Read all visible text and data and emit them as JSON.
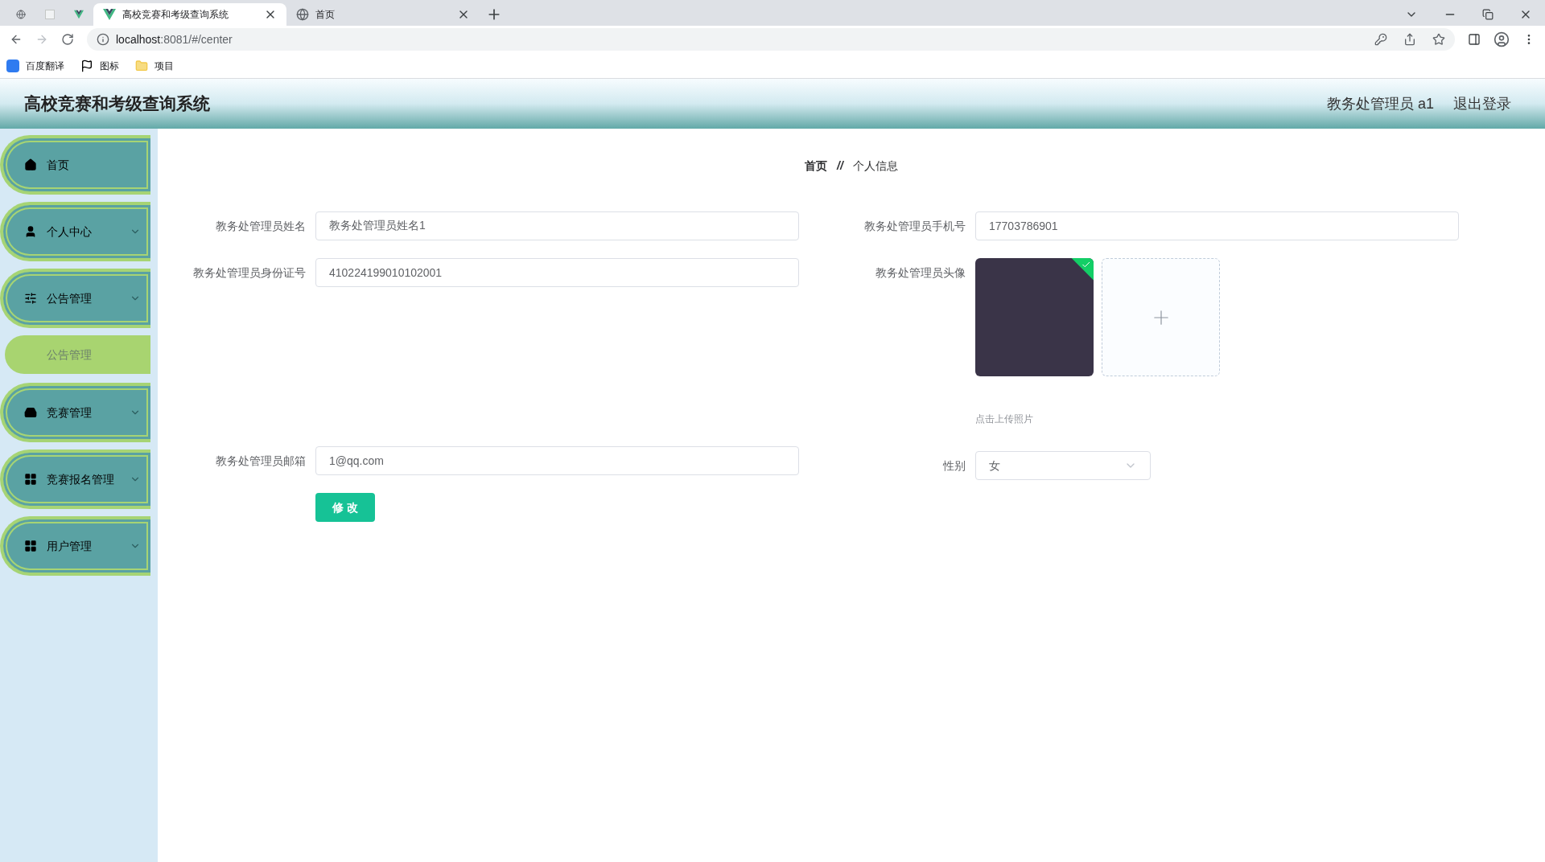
{
  "browser": {
    "tabs": [
      {
        "kind": "globe",
        "selected": false
      },
      {
        "kind": "blank",
        "selected": false
      },
      {
        "kind": "vue",
        "selected": false
      },
      {
        "kind": "vue",
        "title": "高校竞赛和考级查询系统",
        "selected": true
      },
      {
        "kind": "globe",
        "title": "首页",
        "selected": false
      }
    ],
    "address": {
      "host": "localhost",
      "rest": ":8081/#/center"
    },
    "bookmarks": [
      {
        "kind": "translate",
        "label": "百度翻译"
      },
      {
        "kind": "flag",
        "label": "图标"
      },
      {
        "kind": "folder",
        "label": "项目"
      }
    ]
  },
  "header": {
    "title": "高校竞赛和考级查询系统",
    "user": "教务处管理员 a1",
    "logout": "退出登录"
  },
  "sidebar": {
    "items": [
      {
        "kind": "home",
        "label": "首页",
        "expandable": false,
        "selected": false
      },
      {
        "kind": "user",
        "label": "个人中心",
        "expandable": true,
        "selected": false
      },
      {
        "kind": "sliders",
        "label": "公告管理",
        "expandable": true,
        "selected": false,
        "children": [
          {
            "label": "公告管理",
            "selected": true
          }
        ]
      },
      {
        "kind": "tray",
        "label": "竞赛管理",
        "expandable": true,
        "selected": false
      },
      {
        "kind": "grid",
        "label": "竞赛报名管理",
        "expandable": true,
        "selected": false
      },
      {
        "kind": "grid",
        "label": "用户管理",
        "expandable": true,
        "selected": false
      }
    ]
  },
  "breadcrumb": {
    "home": "首页",
    "separator": "//",
    "current": "个人信息"
  },
  "form": {
    "name": {
      "label": "教务处管理员姓名",
      "value": "教务处管理员姓名1"
    },
    "phone": {
      "label": "教务处管理员手机号",
      "value": "17703786901"
    },
    "id_card": {
      "label": "教务处管理员身份证号",
      "value": "410224199010102001"
    },
    "avatar": {
      "label": "教务处管理员头像",
      "uploaded": true,
      "hint": "点击上传照片"
    },
    "email": {
      "label": "教务处管理员邮箱",
      "value": "1@qq.com"
    },
    "gender": {
      "label": "性别",
      "value": "女"
    },
    "submit": "修 改"
  }
}
